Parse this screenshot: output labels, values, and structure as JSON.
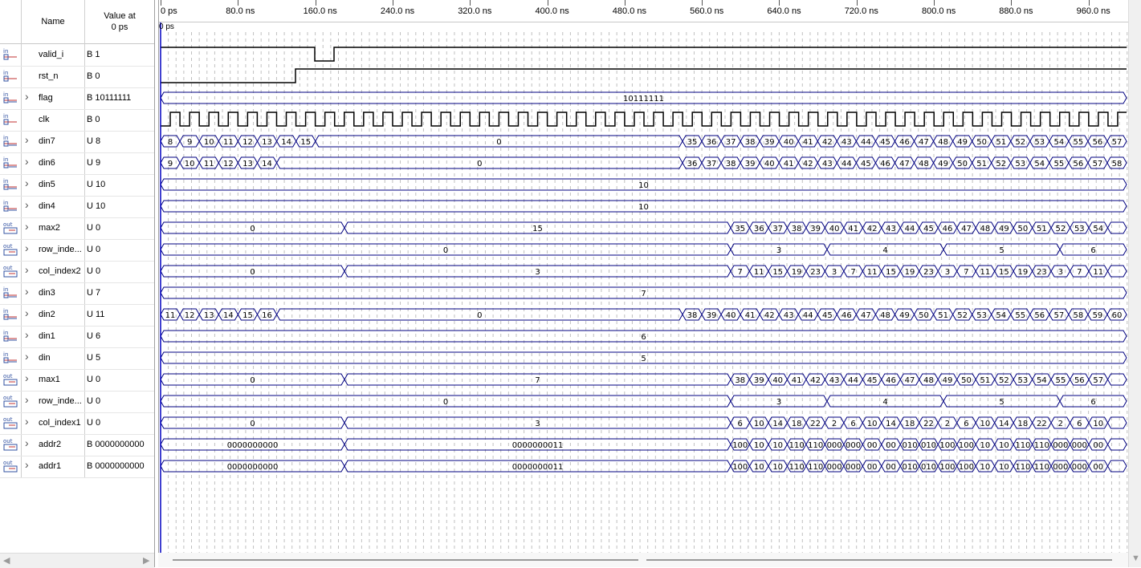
{
  "header": {
    "name_col": "Name",
    "value_col_line1": "Value at",
    "value_col_line2": "0 ps"
  },
  "cursor_label": "0 ps",
  "ruler_ticks": [
    "0 ps",
    "80.0 ns",
    "160.0 ns",
    "240.0 ns",
    "320.0 ns",
    "400.0 ns",
    "480.0 ns",
    "560.0 ns",
    "640.0 ns",
    "720.0 ns",
    "800.0 ns",
    "880.0 ns",
    "960.0 ns"
  ],
  "signals": [
    {
      "name": "valid_i",
      "value": "B 1",
      "dir": "in",
      "bus": false
    },
    {
      "name": "rst_n",
      "value": "B 0",
      "dir": "in",
      "bus": false
    },
    {
      "name": "flag",
      "value": "B 10111111",
      "dir": "in",
      "bus": true
    },
    {
      "name": "clk",
      "value": "B 0",
      "dir": "in",
      "bus": false
    },
    {
      "name": "din7",
      "value": "U 8",
      "dir": "in",
      "bus": true
    },
    {
      "name": "din6",
      "value": "U 9",
      "dir": "in",
      "bus": true
    },
    {
      "name": "din5",
      "value": "U 10",
      "dir": "in",
      "bus": true
    },
    {
      "name": "din4",
      "value": "U 10",
      "dir": "in",
      "bus": true
    },
    {
      "name": "max2",
      "value": "U 0",
      "dir": "out",
      "bus": true
    },
    {
      "name": "row_inde...",
      "value": "U 0",
      "dir": "out",
      "bus": true
    },
    {
      "name": "col_index2",
      "value": "U 0",
      "dir": "out",
      "bus": true
    },
    {
      "name": "din3",
      "value": "U 7",
      "dir": "in",
      "bus": true
    },
    {
      "name": "din2",
      "value": "U 11",
      "dir": "in",
      "bus": true
    },
    {
      "name": "din1",
      "value": "U 6",
      "dir": "in",
      "bus": true
    },
    {
      "name": "din",
      "value": "U 5",
      "dir": "in",
      "bus": true
    },
    {
      "name": "max1",
      "value": "U 0",
      "dir": "out",
      "bus": true
    },
    {
      "name": "row_inde...",
      "value": "U 0",
      "dir": "out",
      "bus": true
    },
    {
      "name": "col_index1",
      "value": "U 0",
      "dir": "out",
      "bus": true
    },
    {
      "name": "addr2",
      "value": "B 0000000000",
      "dir": "out",
      "bus": true
    },
    {
      "name": "addr1",
      "value": "B 0000000000",
      "dir": "out",
      "bus": true
    }
  ],
  "waves": {
    "flag": {
      "label": "10111111"
    },
    "din7": {
      "early": [
        "8",
        "9",
        "10",
        "11",
        "12",
        "13",
        "14",
        "15"
      ],
      "mid": "0",
      "late": [
        "35",
        "36",
        "37",
        "38",
        "39",
        "40",
        "41",
        "42",
        "43",
        "44",
        "45",
        "46",
        "47",
        "48",
        "49",
        "50",
        "51",
        "52",
        "53",
        "54",
        "55",
        "56",
        "57"
      ]
    },
    "din6": {
      "early": [
        "9",
        "10",
        "11",
        "12",
        "13",
        "14"
      ],
      "mid": "0",
      "late": [
        "36",
        "37",
        "38",
        "39",
        "40",
        "41",
        "42",
        "43",
        "44",
        "45",
        "46",
        "47",
        "48",
        "49",
        "50",
        "51",
        "52",
        "53",
        "54",
        "55",
        "56",
        "57",
        "58"
      ]
    },
    "din5": {
      "label": "10"
    },
    "din4": {
      "label": "10"
    },
    "max2": {
      "seg1": "0",
      "seg2": "15",
      "late": [
        "35",
        "36",
        "37",
        "38",
        "39",
        "40",
        "41",
        "42",
        "43",
        "44",
        "45",
        "46",
        "47",
        "48",
        "49",
        "50",
        "51",
        "52",
        "53",
        "54",
        ""
      ]
    },
    "row_index2": {
      "seg1": "0",
      "late": [
        "3",
        "4",
        "5",
        "6"
      ]
    },
    "col_index2": {
      "seg1": "0",
      "seg2": "3",
      "late": [
        "7",
        "11",
        "15",
        "19",
        "23",
        "3",
        "7",
        "11",
        "15",
        "19",
        "23",
        "3",
        "7",
        "11",
        "15",
        "19",
        "23",
        "3",
        "7",
        "11",
        ""
      ]
    },
    "din3": {
      "label": "7"
    },
    "din2": {
      "early": [
        "11",
        "12",
        "13",
        "14",
        "15",
        "16"
      ],
      "mid": "0",
      "late": [
        "38",
        "39",
        "40",
        "41",
        "42",
        "43",
        "44",
        "45",
        "46",
        "47",
        "48",
        "49",
        "50",
        "51",
        "52",
        "53",
        "54",
        "55",
        "56",
        "57",
        "58",
        "59",
        "60"
      ]
    },
    "din1": {
      "label": "6"
    },
    "din": {
      "label": "5"
    },
    "max1": {
      "seg1": "0",
      "seg2": "7",
      "late": [
        "38",
        "39",
        "40",
        "41",
        "42",
        "43",
        "44",
        "45",
        "46",
        "47",
        "48",
        "49",
        "50",
        "51",
        "52",
        "53",
        "54",
        "55",
        "56",
        "57",
        ""
      ]
    },
    "row_index1": {
      "seg1": "0",
      "late": [
        "3",
        "4",
        "5",
        "6"
      ]
    },
    "col_index1": {
      "seg1": "0",
      "seg2": "3",
      "late": [
        "6",
        "10",
        "14",
        "18",
        "22",
        "2",
        "6",
        "10",
        "14",
        "18",
        "22",
        "2",
        "6",
        "10",
        "14",
        "18",
        "22",
        "2",
        "6",
        "10",
        ""
      ]
    },
    "addr2": {
      "seg1": "0000000000",
      "seg2": "0000000011",
      "late": [
        "100",
        "10",
        "10",
        "110",
        "110",
        "000",
        "000",
        "00",
        "00",
        "010",
        "010",
        "100",
        "100",
        "10",
        "10",
        "110",
        "110",
        "000",
        "000",
        "00",
        ""
      ]
    },
    "addr1": {
      "seg1": "0000000000",
      "seg2": "0000000011",
      "late": [
        "100",
        "10",
        "10",
        "110",
        "110",
        "000",
        "000",
        "00",
        "00",
        "010",
        "010",
        "100",
        "100",
        "10",
        "10",
        "110",
        "110",
        "000",
        "000",
        "00",
        ""
      ]
    }
  },
  "colors": {
    "wave": "#000080",
    "bus": "#000080",
    "grid": "#c0c0c0",
    "cursor": "#0000c0"
  },
  "icons": {
    "in": "input-pin-icon",
    "out": "output-pin-icon"
  }
}
